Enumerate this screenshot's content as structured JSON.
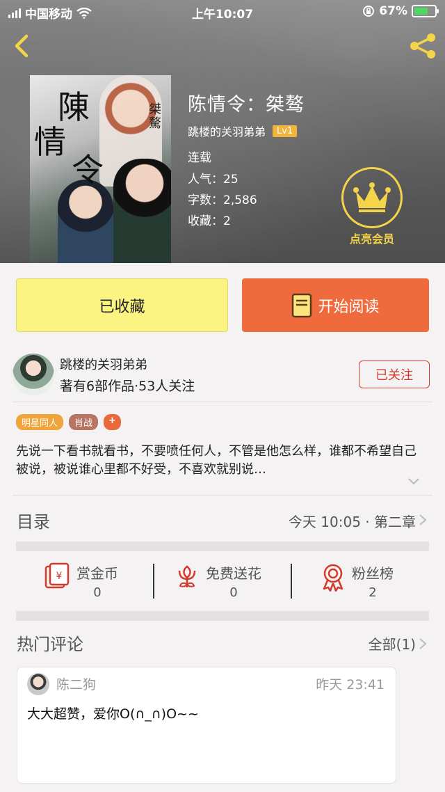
{
  "status_bar": {
    "carrier": "中国移动",
    "time": "上午10:07",
    "battery": "67%",
    "battery_level": 0.67
  },
  "book": {
    "title": "陈情令：桀骜",
    "author": "跳楼的关羽弟弟",
    "level": "Lv1",
    "status": "连载",
    "popularity": "人气：25",
    "words": "字数：2,586",
    "favorites": "收藏：2",
    "cover_text": {
      "c1": "陳",
      "c2": "情",
      "c3": "令",
      "side": "桀驁"
    }
  },
  "vip": {
    "label": "点亮会员"
  },
  "actions": {
    "collect_label": "已收藏",
    "read_label": "开始阅读"
  },
  "author_card": {
    "name": "跳楼的关羽弟弟",
    "stats": "著有6部作品·53人关注",
    "follow_label": "已关注"
  },
  "tags": [
    "明星同人",
    "肖战",
    "+"
  ],
  "synopsis": "先说一下看书就看书，不要喷任何人，不管是他怎么样，谁都不希望自己被说，被说谁心里都不好受，不喜欢就别说…",
  "toc": {
    "label": "目录",
    "latest": "今天 10:05 · 第二章"
  },
  "stats_row": {
    "reward": {
      "name": "赏金币",
      "value": "0"
    },
    "flower": {
      "name": "免费送花",
      "value": "0"
    },
    "fans": {
      "name": "粉丝榜",
      "value": "2"
    }
  },
  "comments": {
    "label": "热门评论",
    "all": "全部(1)",
    "items": [
      {
        "user": "陈二狗",
        "time": "昨天 23:41",
        "body": "大大超赞，爱你O(∩_∩)O~~"
      }
    ]
  },
  "colors": {
    "accent": "#ef6b3d",
    "collect_bg": "#fbf382",
    "vip_gold": "#f3d44a",
    "follow_red": "#d33a2c"
  }
}
